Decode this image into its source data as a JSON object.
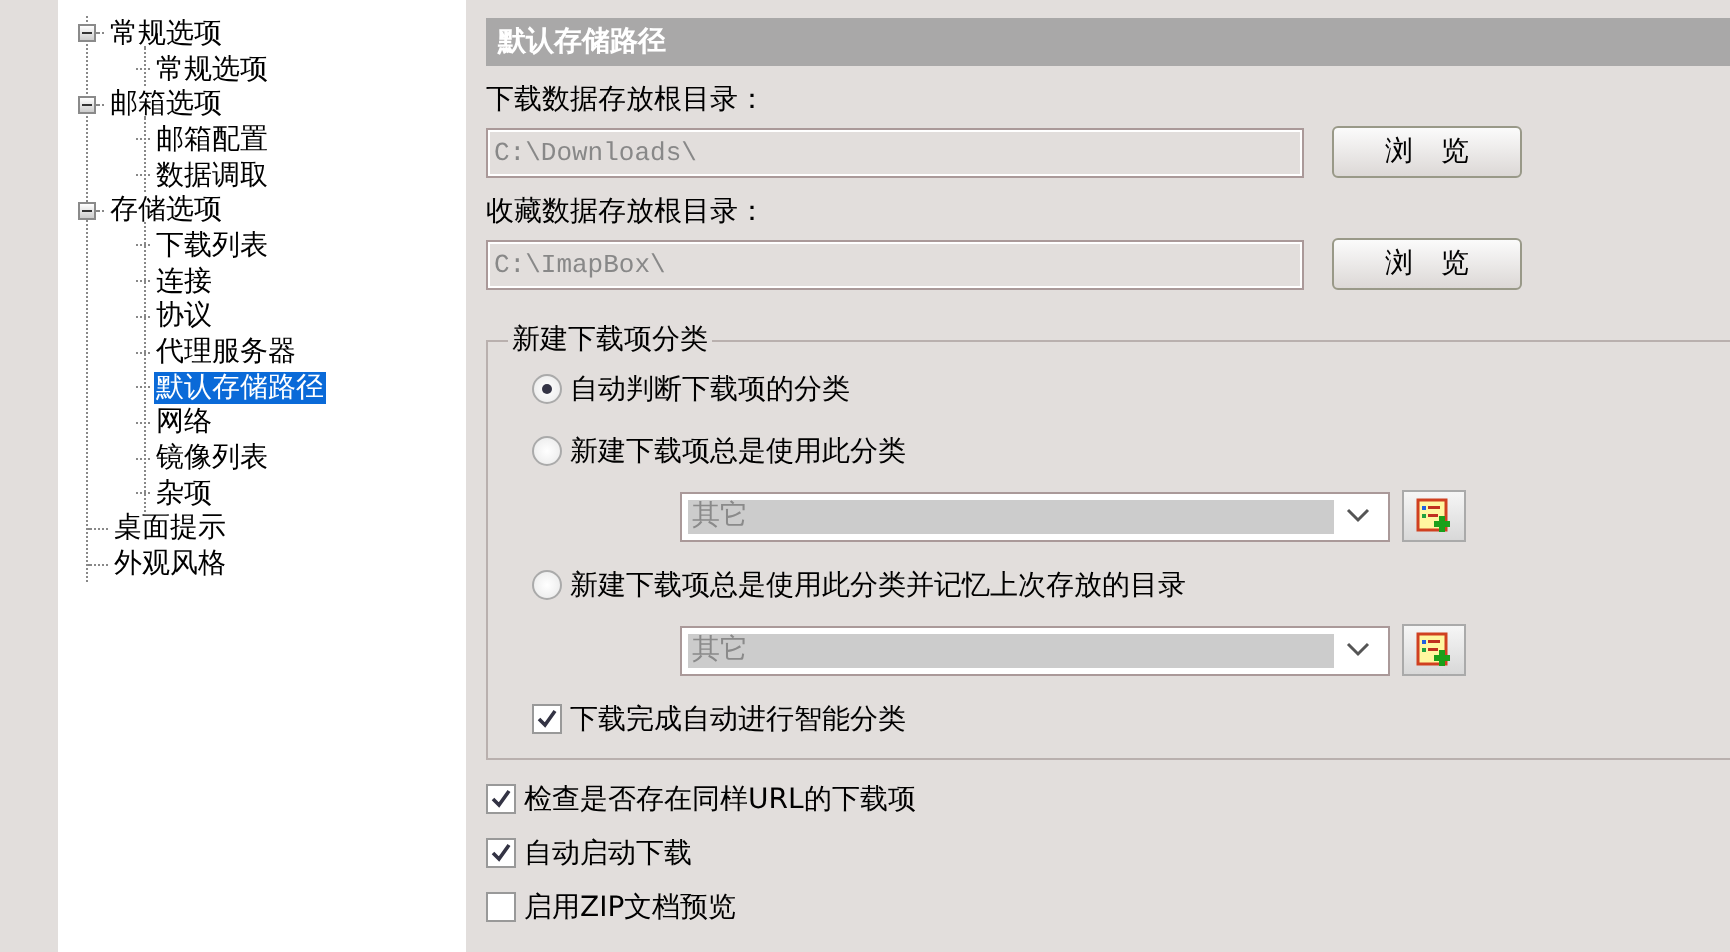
{
  "sidebar": {
    "items": [
      {
        "label": "常规选项",
        "selected": false,
        "expanded": true,
        "children": [
          {
            "label": "常规选项",
            "selected": false
          }
        ]
      },
      {
        "label": "邮箱选项",
        "selected": false,
        "expanded": true,
        "children": [
          {
            "label": "邮箱配置",
            "selected": false
          },
          {
            "label": "数据调取",
            "selected": false
          }
        ]
      },
      {
        "label": "存储选项",
        "selected": false,
        "expanded": true,
        "children": [
          {
            "label": "下载列表",
            "selected": false
          },
          {
            "label": "连接",
            "selected": false
          },
          {
            "label": "协议",
            "selected": false
          },
          {
            "label": "代理服务器",
            "selected": false
          },
          {
            "label": "默认存储路径",
            "selected": true
          },
          {
            "label": "网络",
            "selected": false
          },
          {
            "label": "镜像列表",
            "selected": false
          },
          {
            "label": "杂项",
            "selected": false
          }
        ]
      },
      {
        "label": "桌面提示",
        "selected": false
      },
      {
        "label": "外观风格",
        "selected": false
      }
    ]
  },
  "section_title": "默认存储路径",
  "paths": [
    {
      "label": "下载数据存放根目录：",
      "value": "C:\\Downloads\\",
      "button": "浏 览"
    },
    {
      "label": "收藏数据存放根目录：",
      "value": "C:\\ImapBox\\",
      "button": "浏 览"
    }
  ],
  "group": {
    "title": "新建下载项分类",
    "options": [
      {
        "label": "自动判断下载项的分类",
        "selected": true
      },
      {
        "label": "新建下载项总是使用此分类",
        "selected": false,
        "category": {
          "value": "其它",
          "disabled": true
        }
      },
      {
        "label": "新建下载项总是使用此分类并记忆上次存放的目录",
        "selected": false,
        "category": {
          "value": "其它",
          "disabled": true
        }
      }
    ],
    "checkbox": {
      "label": "下载完成自动进行智能分类",
      "checked": true
    }
  },
  "checkboxes": [
    {
      "label": "检查是否存在同样URL的下载项",
      "checked": true
    },
    {
      "label": "自动启动下载",
      "checked": true
    },
    {
      "label": "启用ZIP文档预览",
      "checked": false
    }
  ]
}
